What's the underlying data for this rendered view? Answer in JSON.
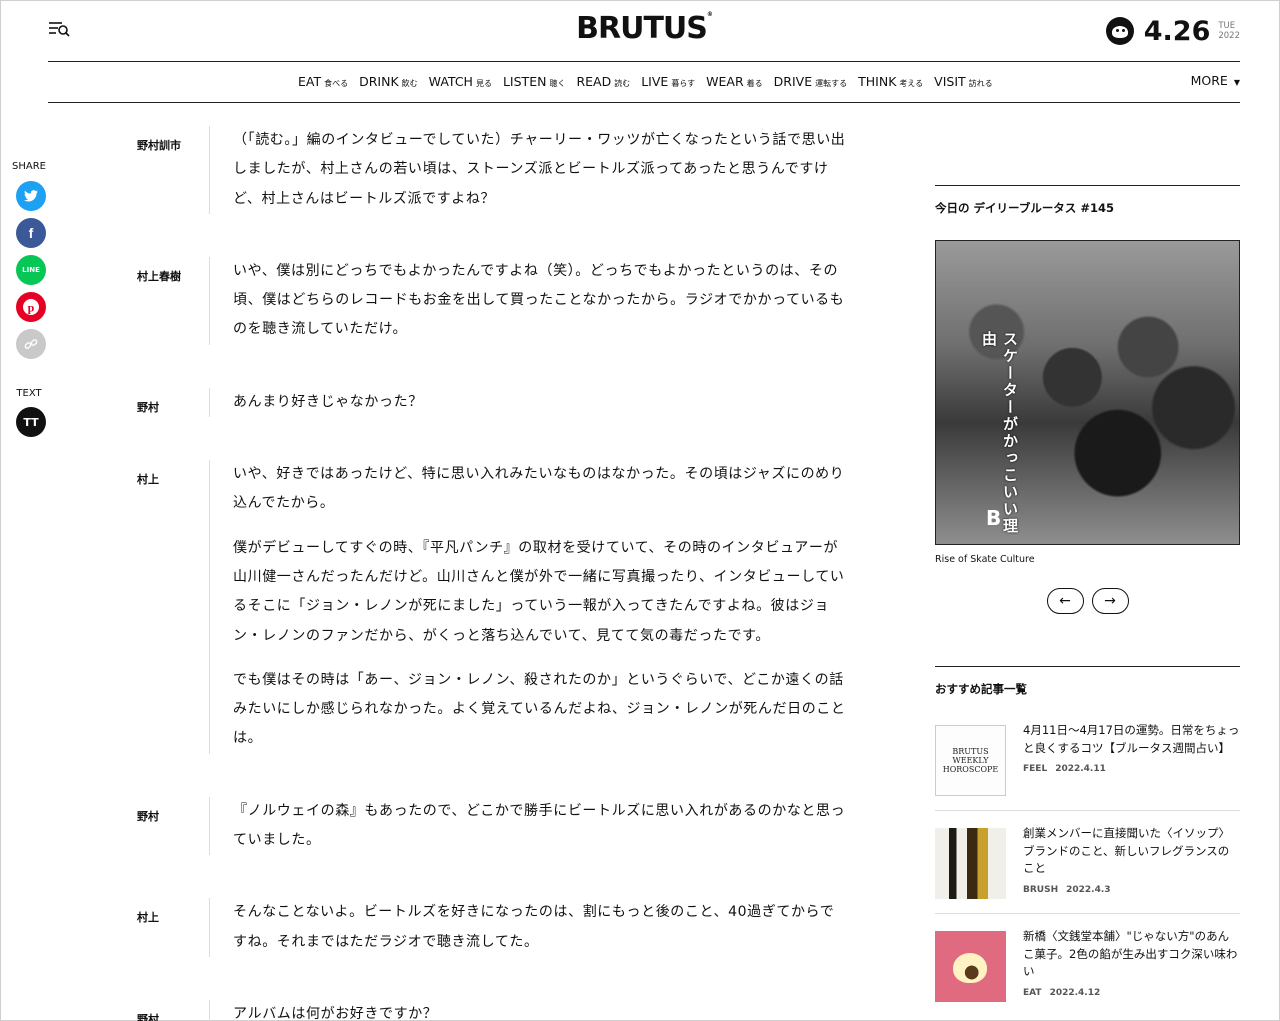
{
  "header": {
    "logo": "BRUTUS",
    "date": "4.26",
    "weekday": "TUE",
    "year": "2022"
  },
  "nav": {
    "items": [
      {
        "en": "EAT",
        "jp": "食べる"
      },
      {
        "en": "DRINK",
        "jp": "飲む"
      },
      {
        "en": "WATCH",
        "jp": "見る"
      },
      {
        "en": "LISTEN",
        "jp": "聴く"
      },
      {
        "en": "READ",
        "jp": "読む"
      },
      {
        "en": "LIVE",
        "jp": "暮らす"
      },
      {
        "en": "WEAR",
        "jp": "着る"
      },
      {
        "en": "DRIVE",
        "jp": "運転する"
      },
      {
        "en": "THINK",
        "jp": "考える"
      },
      {
        "en": "VISIT",
        "jp": "訪れる"
      }
    ],
    "more": "MORE"
  },
  "share": {
    "title": "SHARE",
    "line_label": "LINE",
    "text_title": "TEXT",
    "text_button": "TT"
  },
  "article": {
    "dialogue": [
      {
        "speaker": "野村訓市",
        "paragraphs": [
          "（「読む。」編のインタビューでしていた）チャーリー・ワッツが亡くなったという話で思い出しましたが、村上さんの若い頃は、ストーンズ派とビートルズ派ってあったと思うんですけど、村上さんはビートルズ派ですよね？"
        ]
      },
      {
        "speaker": "村上春樹",
        "paragraphs": [
          "いや、僕は別にどっちでもよかったんですよね（笑）。どっちでもよかったというのは、その頃、僕はどちらのレコードもお金を出して買ったことなかったから。ラジオでかかっているものを聴き流していただけ。"
        ]
      },
      {
        "speaker": "野村",
        "paragraphs": [
          "あんまり好きじゃなかった？"
        ]
      },
      {
        "speaker": "村上",
        "paragraphs": [
          "いや、好きではあったけど、特に思い入れみたいなものはなかった。その頃はジャズにのめり込んでたから。",
          "僕がデビューしてすぐの時、『平凡パンチ』の取材を受けていて、その時のインタビュアーが山川健一さんだったんだけど。山川さんと僕が外で一緒に写真撮ったり、インタビューしているそこに「ジョン・レノンが死にました」っていう一報が入ってきたんですよね。彼はジョン・レノンのファンだから、がくっと落ち込んでいて、見てて気の毒だったです。",
          "でも僕はその時は「あー、ジョン・レノン、殺されたのか」というぐらいで、どこか遠くの話みたいにしか感じられなかった。よく覚えているんだよね、ジョン・レノンが死んだ日のことは。"
        ]
      },
      {
        "speaker": "野村",
        "paragraphs": [
          "『ノルウェイの森』もあったので、どこかで勝手にビートルズに思い入れがあるのかなと思っていました。"
        ]
      },
      {
        "speaker": "村上",
        "paragraphs": [
          "そんなことないよ。ビートルズを好きになったのは、割にもっと後のこと、40過ぎてからですね。それまではただラジオで聴き流してた。"
        ]
      },
      {
        "speaker": "野村",
        "paragraphs": [
          "アルバムは何がお好きですか？"
        ]
      }
    ]
  },
  "sidebar": {
    "daily_title": "今日の デイリーブルータス #145",
    "cover_text": "スケーターがかっこいい理由",
    "cover_mark": "B",
    "cover_caption": "Rise of Skate Culture",
    "prev_label": "←",
    "next_label": "→",
    "recommend_title": "おすすめ記事一覧",
    "thumb1_text": "BRUTUS WEEKLY HOROSCOPE",
    "articles": [
      {
        "title": "4月11日〜4月17日の運勢。日常をちょっと良くするコツ【ブルータス週間占い】",
        "category": "FEEL",
        "date": "2022.4.11"
      },
      {
        "title": "創業メンバーに直接聞いた〈イソップ〉ブランドのこと、新しいフレグランスのこと",
        "category": "BRUSH",
        "date": "2022.4.3"
      },
      {
        "title": "新橋〈文銭堂本舗〉\"じゃない方\"のあんこ菓子。2色の餡が生み出すコク深い味わい",
        "category": "EAT",
        "date": "2022.4.12"
      }
    ]
  }
}
